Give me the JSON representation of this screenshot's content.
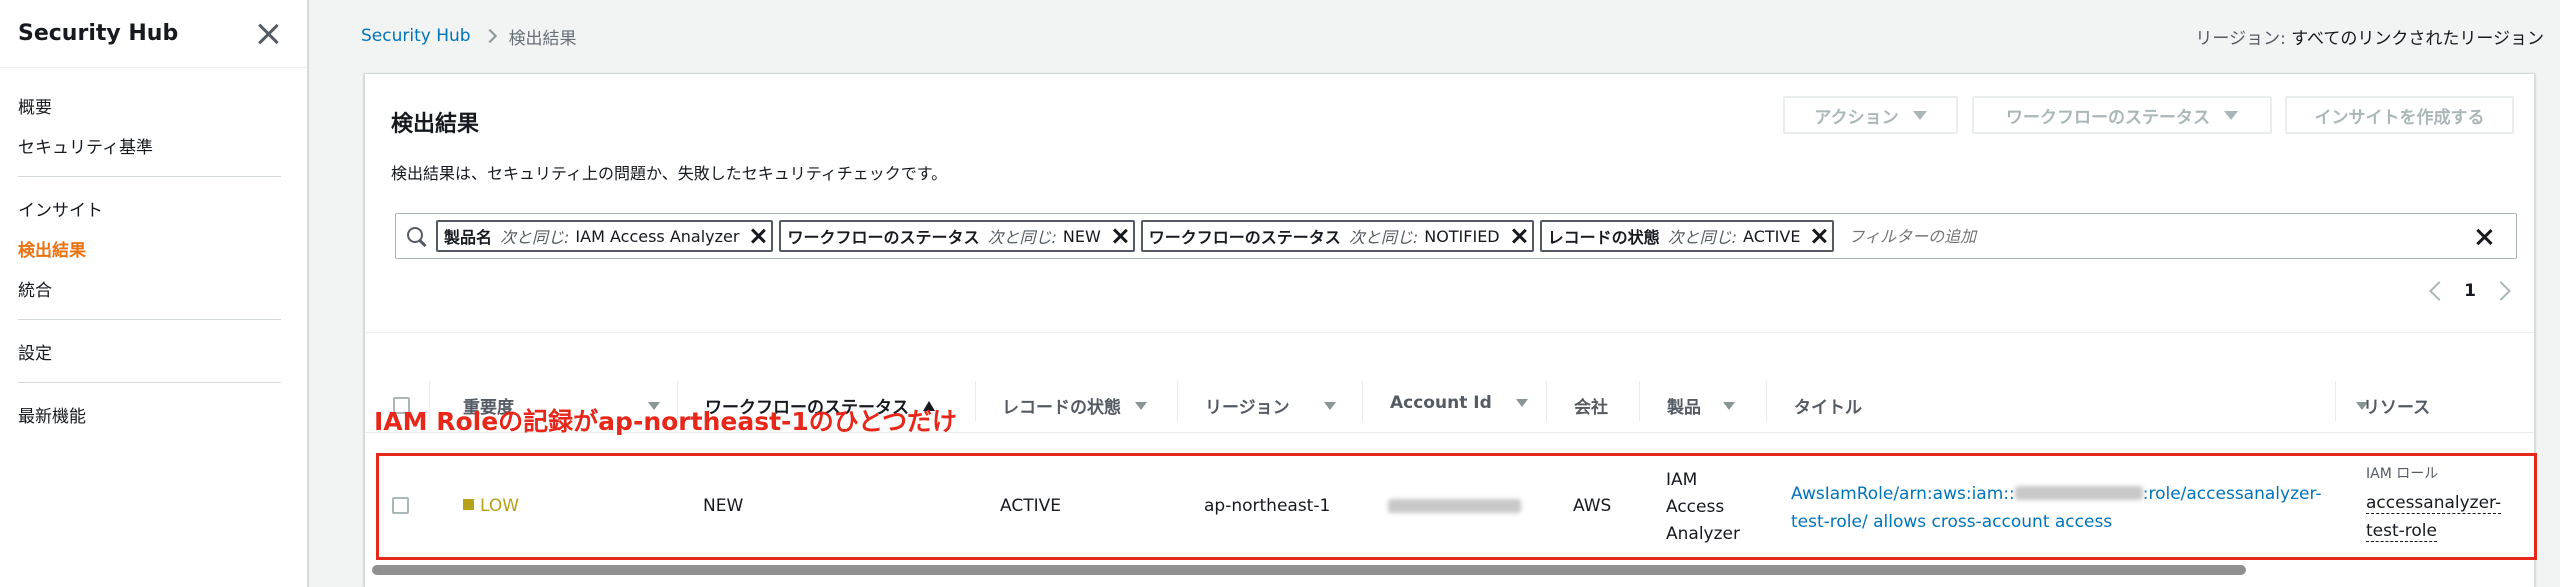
{
  "sidebar": {
    "title": "Security Hub",
    "sections": [
      [
        "概要",
        "セキュリティ基準"
      ],
      [
        "インサイト",
        "検出結果",
        "統合"
      ],
      [
        "設定"
      ],
      [
        "最新機能"
      ]
    ],
    "items": {
      "overview": "概要",
      "standards": "セキュリティ基準",
      "insights": "インサイト",
      "findings": "検出結果",
      "integrations": "統合",
      "settings": "設定",
      "whats_new": "最新機能"
    },
    "active": "検出結果"
  },
  "breadcrumb": {
    "root": "Security Hub",
    "current": "検出結果"
  },
  "region": {
    "label": "リージョン:",
    "value": "すべてのリンクされたリージョン"
  },
  "panel": {
    "title": "検出結果",
    "description": "検出結果は、セキュリティ上の問題か、失敗したセキュリティチェックです。",
    "buttons": {
      "actions": "アクション",
      "workflow_status": "ワークフローのステータス",
      "create_insight": "インサイトを作成する"
    }
  },
  "filters": [
    {
      "field": "製品名",
      "op": "次と同じ:",
      "value": "IAM Access Analyzer"
    },
    {
      "field": "ワークフローのステータス",
      "op": "次と同じ:",
      "value": "NEW"
    },
    {
      "field": "ワークフローのステータス",
      "op": "次と同じ:",
      "value": "NOTIFIED"
    },
    {
      "field": "レコードの状態",
      "op": "次と同じ:",
      "value": "ACTIVE"
    }
  ],
  "filter_placeholder": "フィルターの追加",
  "pagination": {
    "page": "1"
  },
  "table": {
    "columns": {
      "severity": "重要度",
      "workflow": "ワークフローのステータス",
      "record_state": "レコードの状態",
      "region": "リージョン",
      "account": "Account Id",
      "company": "会社",
      "product": "製品",
      "title": "タイトル",
      "resource": "リソース"
    },
    "row": {
      "severity": "LOW",
      "workflow": "NEW",
      "record_state": "ACTIVE",
      "region": "ap-northeast-1",
      "company": "AWS",
      "product_1": "IAM",
      "product_2": "Access",
      "product_3": "Analyzer",
      "title_1a": "AwsIamRole/arn:aws:iam::",
      "title_1b": ":role/accessanalyzer-",
      "title_2": "test-role/ allows cross-account access",
      "resource_type": "IAM ロール",
      "resource_1": "accessanalyzer-",
      "resource_2": "test-role"
    }
  },
  "annotation": "IAM Roleの記録がap-northeast-1のひとつだけ",
  "colors": {
    "accent": "#ec7211",
    "link": "#0073bb",
    "annotation": "#e8271b",
    "low_severity": "#b7a01a"
  }
}
